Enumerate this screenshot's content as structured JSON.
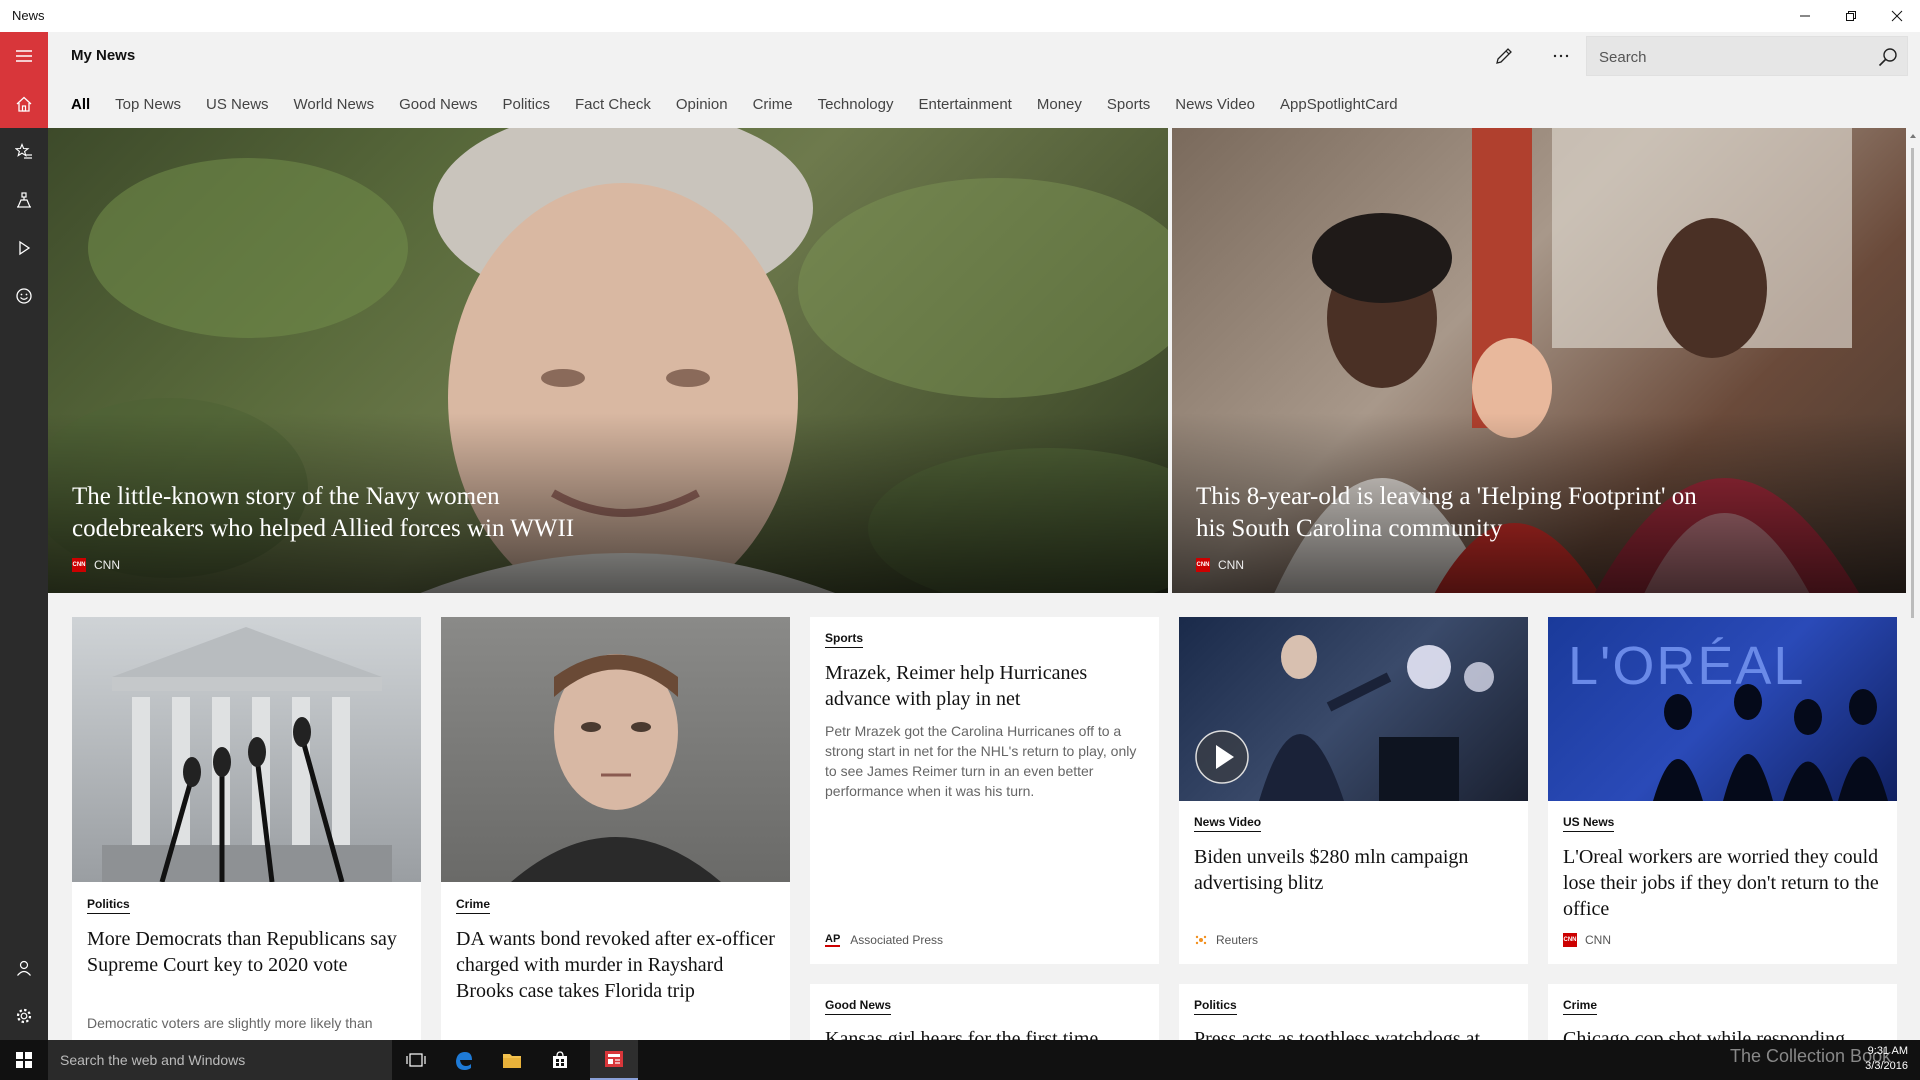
{
  "window": {
    "app_name": "News"
  },
  "header": {
    "title": "My News",
    "search_placeholder": "Search"
  },
  "tabs": [
    "All",
    "Top News",
    "US News",
    "World News",
    "Good News",
    "Politics",
    "Fact Check",
    "Opinion",
    "Crime",
    "Technology",
    "Entertainment",
    "Money",
    "Sports",
    "News Video",
    "AppSpotlightCard"
  ],
  "heroes": [
    {
      "title": "The little-known story of the Navy women codebreakers who helped Allied forces win WWII",
      "source": "CNN"
    },
    {
      "title": "This 8-year-old is leaving a 'Helping Footprint' on his South Carolina community",
      "source": "CNN"
    }
  ],
  "cards": [
    {
      "category": "Politics",
      "title": "More Democrats than Republicans say Supreme Court key to 2020 vote",
      "desc": "Democratic voters are slightly more likely than"
    },
    {
      "category": "Crime",
      "title": "DA wants bond revoked after ex-officer charged with murder in Rayshard Brooks case takes Florida trip"
    },
    {
      "category": "Sports",
      "title": "Mrazek, Reimer help Hurricanes advance with play in net",
      "desc": "Petr Mrazek got the Carolina Hurricanes off to a strong start in net for the NHL's return to play, only to see James Reimer turn in an even better performance when it was his turn.",
      "source": "Associated Press",
      "source_logo": "AP"
    },
    {
      "category": "News Video",
      "title": "Biden unveils $280 mln campaign advertising blitz",
      "source": "Reuters"
    },
    {
      "category": "US News",
      "title": "L'Oreal workers are worried they could lose their jobs if they don't return to the office",
      "source": "CNN",
      "image_text": "L'ORÉAL"
    }
  ],
  "bottom_cards": [
    {
      "category": "Good News",
      "title": "Kansas girl hears for the first time"
    },
    {
      "category": "Politics",
      "title": "Press acts as toothless watchdogs at"
    },
    {
      "category": "Crime",
      "title": "Chicago cop shot while responding"
    }
  ],
  "taskbar": {
    "search_text": "Search the web and Windows",
    "time": "9:31 AM",
    "date": "3/3/2016",
    "watermark": "The Collection Book"
  },
  "colors": {
    "accent": "#d8363a",
    "rail": "#2b2b2b",
    "cnn": "#cc0000"
  }
}
